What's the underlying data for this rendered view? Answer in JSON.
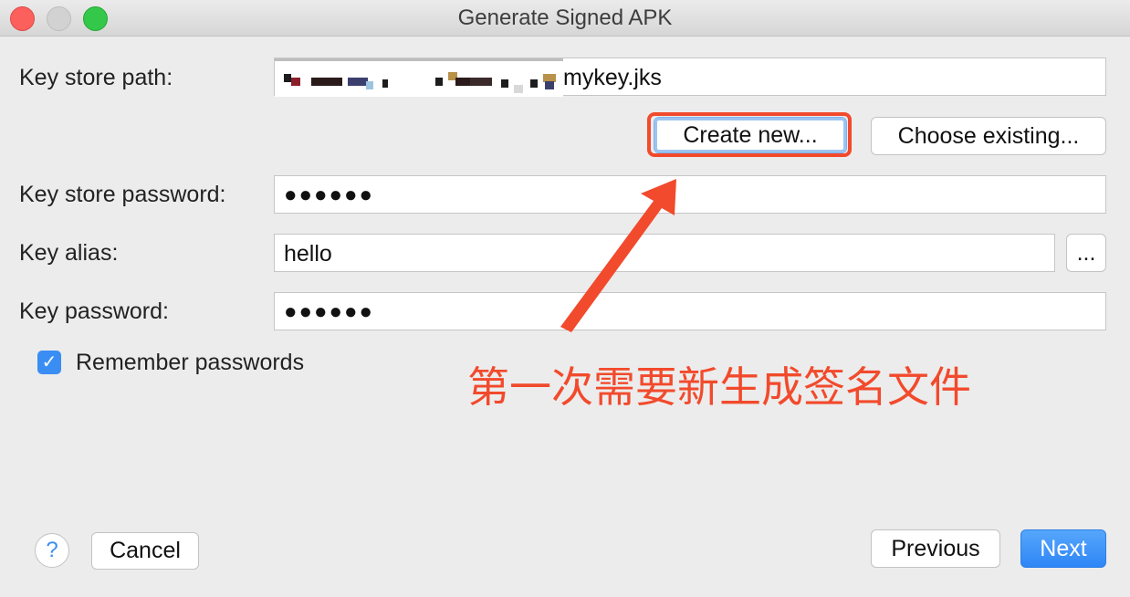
{
  "window": {
    "title": "Generate Signed APK"
  },
  "form": {
    "key_store_path_label": "Key store path:",
    "key_store_path_value": "mykey.jks",
    "create_new_label": "Create new...",
    "choose_existing_label": "Choose existing...",
    "key_store_password_label": "Key store password:",
    "key_store_password_value": "●●●●●●",
    "key_alias_label": "Key alias:",
    "key_alias_value": "hello",
    "browse_alias_label": "...",
    "key_password_label": "Key password:",
    "key_password_value": "●●●●●●",
    "remember_passwords_label": "Remember passwords",
    "remember_passwords_checked": true
  },
  "annotation": {
    "text": "第一次需要新生成签名文件",
    "color": "#f24a2c"
  },
  "footer": {
    "help_label": "?",
    "cancel_label": "Cancel",
    "previous_label": "Previous",
    "next_label": "Next"
  },
  "icons": {
    "close": "close-window-icon",
    "minimize": "minimize-window-icon",
    "maximize": "maximize-window-icon",
    "check": "checkmark-icon",
    "help": "help-icon",
    "arrow": "annotation-arrow-icon"
  }
}
